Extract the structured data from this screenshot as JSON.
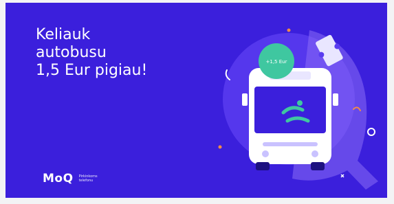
{
  "headline": {
    "line1": "Keliauk",
    "line2": "autobusu",
    "line3": "1,5 Eur pigiau!"
  },
  "brand": {
    "logo": "MoQ",
    "tagline_line1": "Pirkinkoms",
    "tagline_line2": "telefonu"
  },
  "badge": {
    "label": "+1,5 Eur"
  },
  "colors": {
    "background": "#3b1fdc",
    "badge": "#3fc7a0",
    "bus": "#ffffff",
    "accent_orange": "#f08a4b"
  }
}
